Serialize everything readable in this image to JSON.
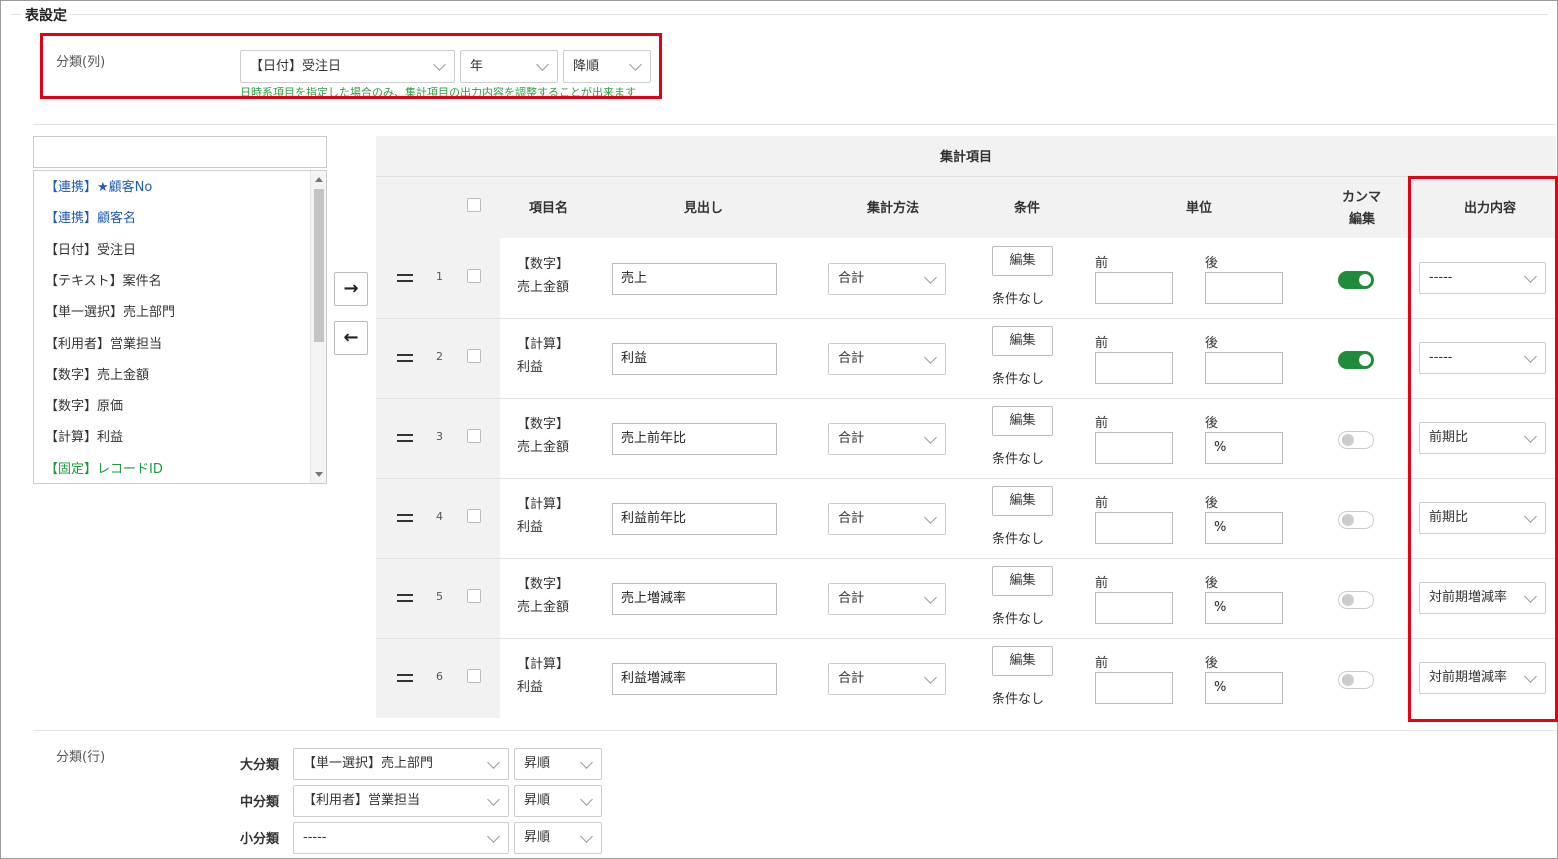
{
  "section": {
    "title": "表設定"
  },
  "column_class": {
    "label": "分類(列)",
    "field": "【日付】受注日",
    "unit": "年",
    "order": "降順",
    "hint": "日時系項目を指定した場合のみ、集計項目の出力内容を調整することが出来ます"
  },
  "field_list": {
    "search_placeholder": "",
    "items": [
      {
        "label": "【連携】★顧客No",
        "color": "#1f5bb8"
      },
      {
        "label": "【連携】顧客名",
        "color": "#1f5bb8"
      },
      {
        "label": "【日付】受注日",
        "color": "#333333"
      },
      {
        "label": "【テキスト】案件名",
        "color": "#333333"
      },
      {
        "label": "【単一選択】売上部門",
        "color": "#333333"
      },
      {
        "label": "【利用者】営業担当",
        "color": "#333333"
      },
      {
        "label": "【数字】売上金額",
        "color": "#333333"
      },
      {
        "label": "【数字】原価",
        "color": "#333333"
      },
      {
        "label": "【計算】利益",
        "color": "#333333"
      },
      {
        "label": "【固定】レコードID",
        "color": "#1a9a3a"
      }
    ]
  },
  "move_buttons": {
    "add": "→",
    "remove": "←"
  },
  "table": {
    "group_header": "集計項目",
    "headers": {
      "item": "項目名",
      "heading": "見出し",
      "method": "集計方法",
      "condition": "条件",
      "unit": "単位",
      "comma_1": "カンマ",
      "comma_2": "編集",
      "output": "出力内容"
    },
    "edit_label": "編集",
    "no_condition": "条件なし",
    "before_label": "前",
    "after_label": "後",
    "rows": [
      {
        "num": "1",
        "type": "【数字】",
        "field": "売上金額",
        "heading": "売上",
        "method": "合計",
        "prefix": "",
        "suffix": "",
        "comma": true,
        "output": "-----"
      },
      {
        "num": "2",
        "type": "【計算】",
        "field": "利益",
        "heading": "利益",
        "method": "合計",
        "prefix": "",
        "suffix": "",
        "comma": true,
        "output": "-----"
      },
      {
        "num": "3",
        "type": "【数字】",
        "field": "売上金額",
        "heading": "売上前年比",
        "method": "合計",
        "prefix": "",
        "suffix": "%",
        "comma": false,
        "output": "前期比"
      },
      {
        "num": "4",
        "type": "【計算】",
        "field": "利益",
        "heading": "利益前年比",
        "method": "合計",
        "prefix": "",
        "suffix": "%",
        "comma": false,
        "output": "前期比"
      },
      {
        "num": "5",
        "type": "【数字】",
        "field": "売上金額",
        "heading": "売上増減率",
        "method": "合計",
        "prefix": "",
        "suffix": "%",
        "comma": false,
        "output": "対前期増減率"
      },
      {
        "num": "6",
        "type": "【計算】",
        "field": "利益",
        "heading": "利益増減率",
        "method": "合計",
        "prefix": "",
        "suffix": "%",
        "comma": false,
        "output": "対前期増減率"
      }
    ]
  },
  "row_class": {
    "label": "分類(行)",
    "levels": [
      {
        "name": "大分類",
        "field": "【単一選択】売上部門",
        "order": "昇順"
      },
      {
        "name": "中分類",
        "field": "【利用者】営業担当",
        "order": "昇順"
      },
      {
        "name": "小分類",
        "field": "-----",
        "order": "昇順"
      }
    ]
  },
  "colors": {
    "highlight": "#e60012",
    "toggle_on": "#1e8c3a",
    "hint": "#28a045"
  }
}
